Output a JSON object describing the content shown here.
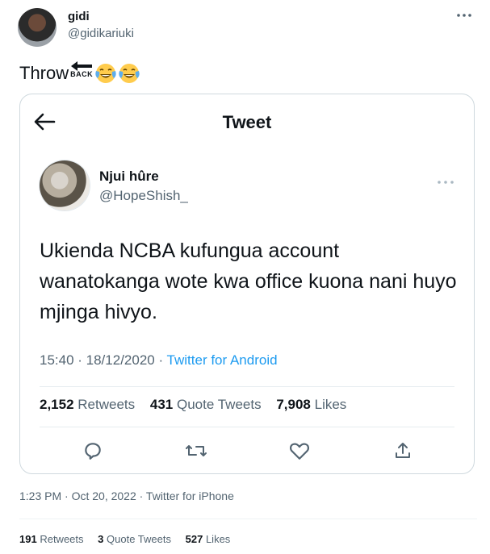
{
  "outer": {
    "display_name": "gidi",
    "handle": "@gidikariuki",
    "text_word": "Throw",
    "back_label": "BACK",
    "emoji": [
      "face-with-tears-of-joy",
      "face-with-tears-of-joy"
    ],
    "timestamp": "1:23 PM · Oct 20, 2022 · Twitter for iPhone",
    "stats": {
      "retweets_count": "191",
      "retweets_label": "Retweets",
      "quotes_count": "3",
      "quotes_label": "Quote Tweets",
      "likes_count": "527",
      "likes_label": "Likes"
    }
  },
  "quoted": {
    "header_title": "Tweet",
    "display_name": "Njui hûre",
    "handle": "@HopeShish_",
    "text": "Ukienda NCBA kufungua account wanatokanga wote kwa office kuona nani huyo mjinga hivyo.",
    "time": "15:40 · 18/12/2020 · ",
    "source": "Twitter for Android",
    "stats": {
      "retweets_count": "2,152",
      "retweets_label": "Retweets",
      "quotes_count": "431",
      "quotes_label": "Quote Tweets",
      "likes_count": "7,908",
      "likes_label": "Likes"
    },
    "actions": [
      "reply-icon",
      "retweet-icon",
      "like-icon",
      "share-icon"
    ]
  },
  "colors": {
    "accent": "#1d9bf0",
    "secondary_text": "#536471",
    "border": "#cfd9de"
  }
}
